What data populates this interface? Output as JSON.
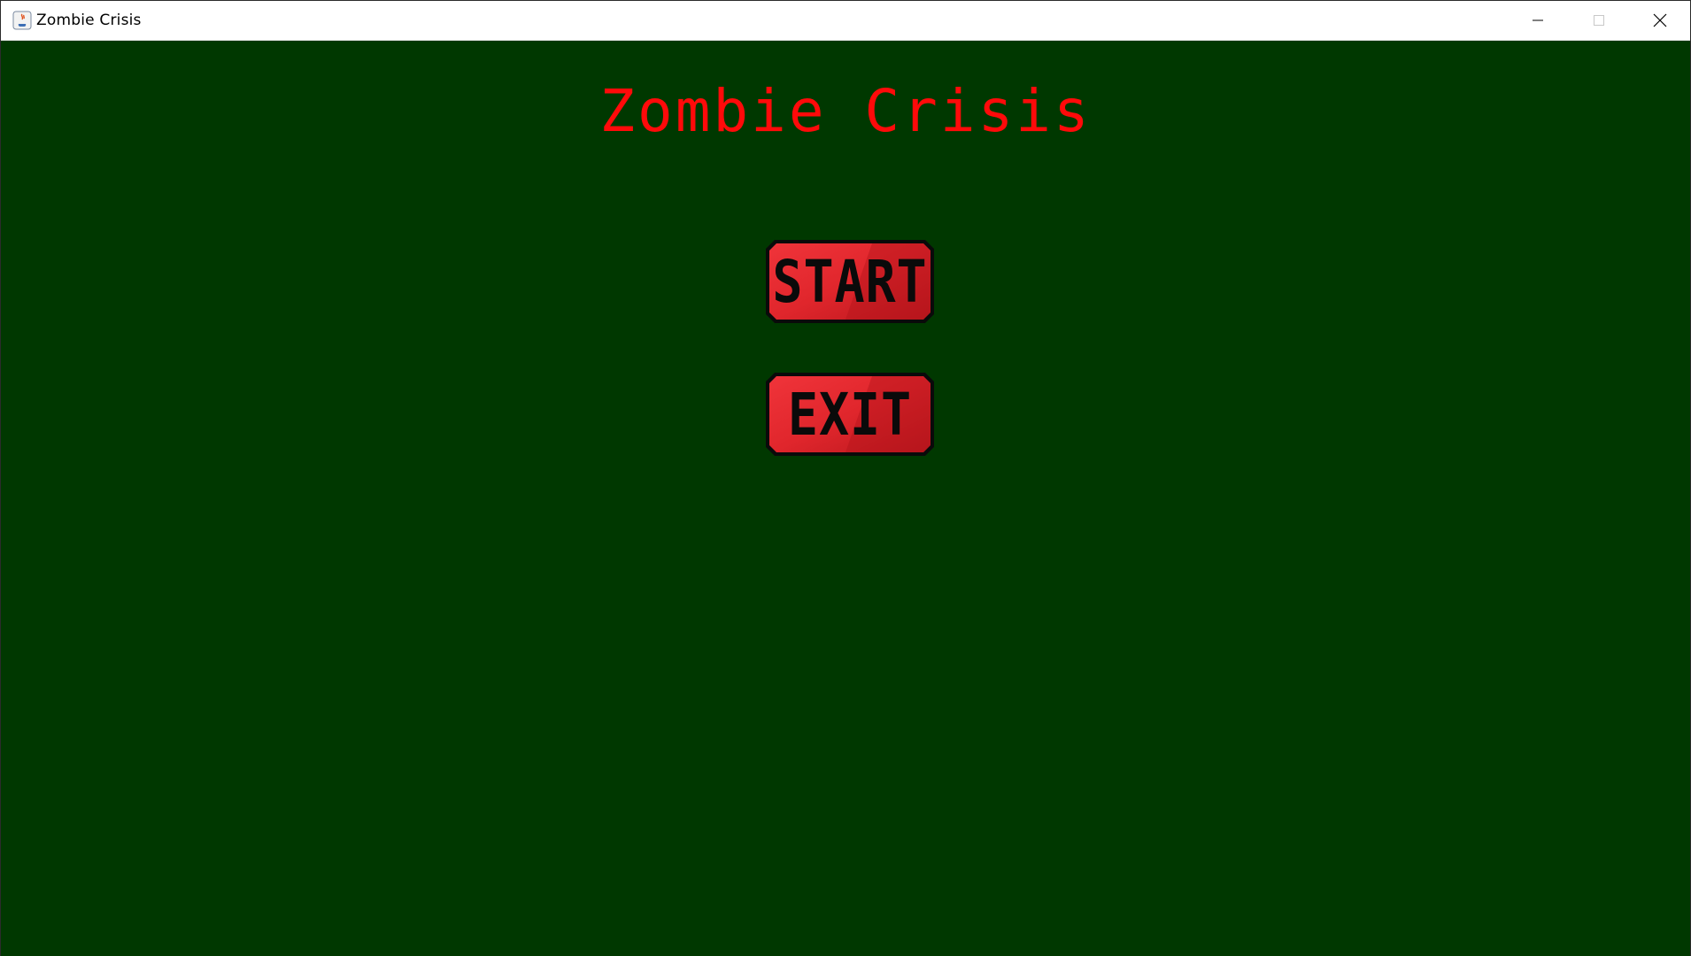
{
  "window": {
    "title": "Zombie Crisis",
    "icons": [
      "java-app-icon",
      "minimize-icon",
      "maximize-icon",
      "close-icon"
    ]
  },
  "game": {
    "title": "Zombie Crisis",
    "buttons": {
      "start_label": "START",
      "exit_label": "EXIT"
    }
  },
  "colors": {
    "background": "#003800",
    "title_red": "#ff0a0a",
    "button_red": "#e8282e",
    "button_dark_red": "#b3151b",
    "button_outline": "#0a0a0a"
  }
}
